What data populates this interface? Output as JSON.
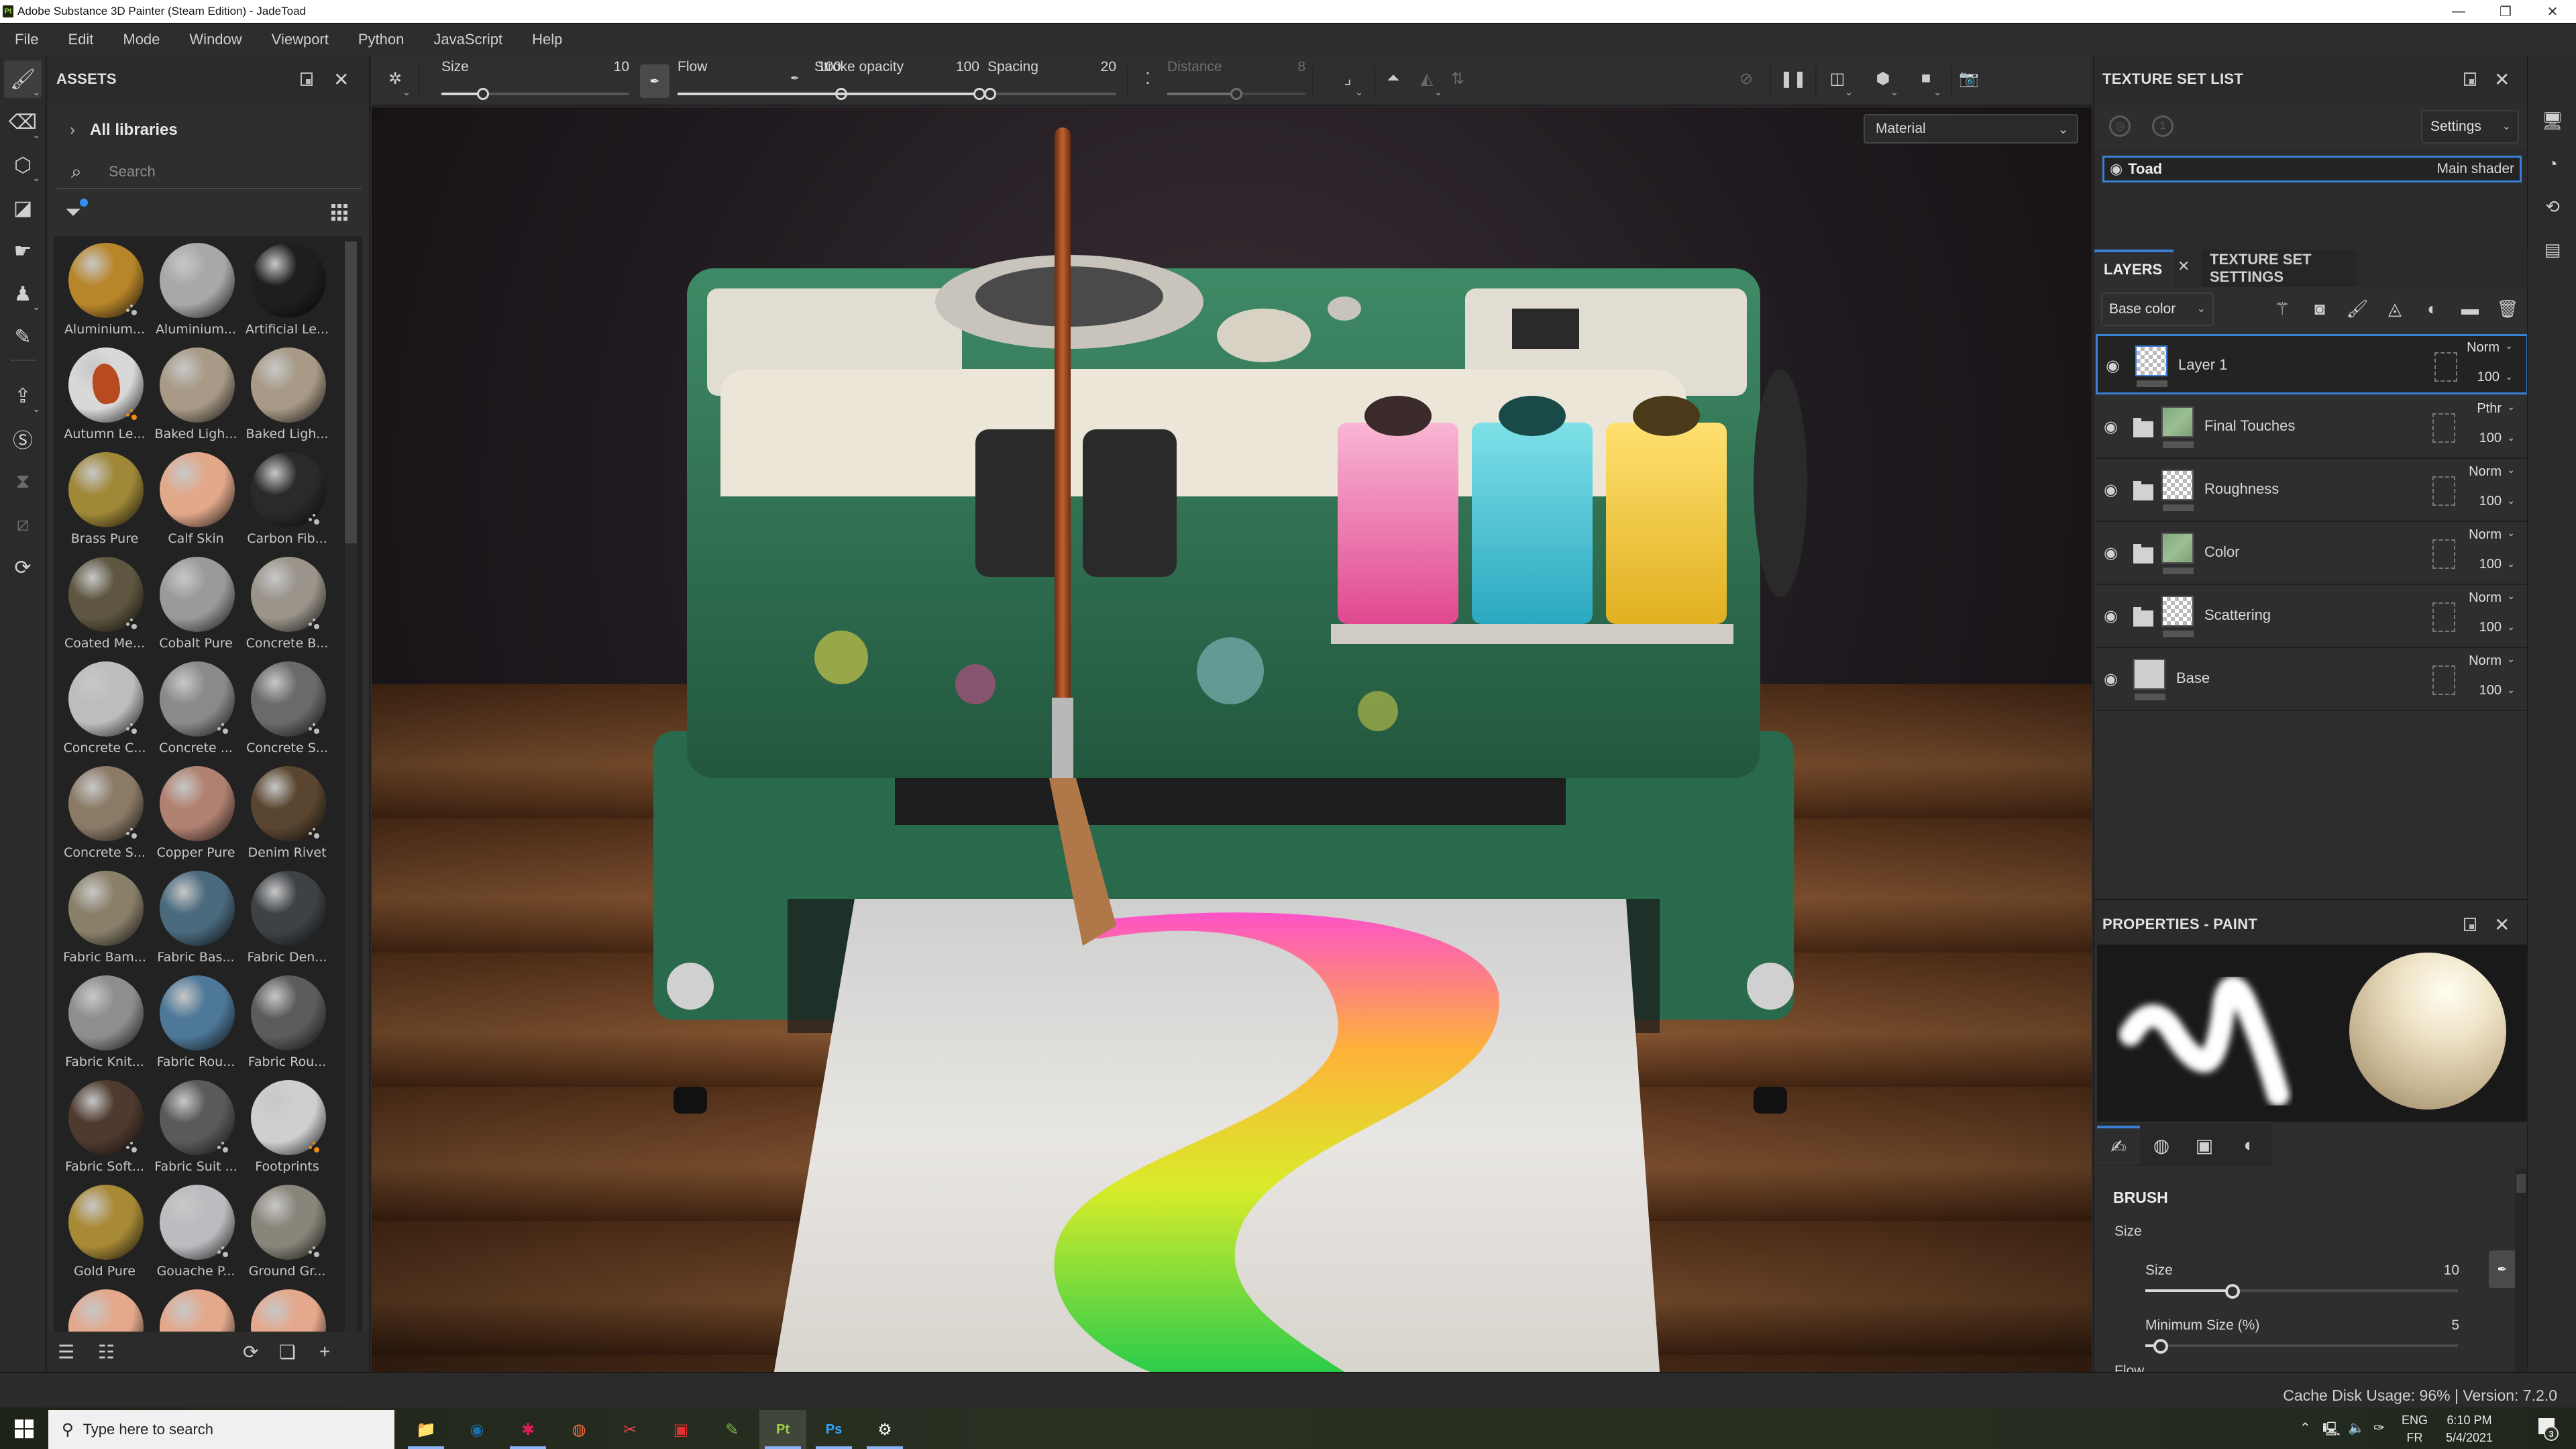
{
  "window": {
    "title": "Adobe Substance 3D Painter (Steam Edition) - JadeToad",
    "app_icon_text": "Pt",
    "controls": {
      "minimize": "—",
      "restore": "❐",
      "close": "✕"
    }
  },
  "menu": [
    "File",
    "Edit",
    "Mode",
    "Window",
    "Viewport",
    "Python",
    "JavaScript",
    "Help"
  ],
  "left_tools": [
    {
      "name": "paint-brush-tool",
      "glyph": "🖌",
      "active": true,
      "caret": true
    },
    {
      "name": "eraser-tool",
      "glyph": "⌫",
      "caret": true
    },
    {
      "name": "projection-tool",
      "glyph": "⬡",
      "caret": true
    },
    {
      "name": "geometry-fill-tool",
      "glyph": "◪"
    },
    {
      "name": "smudge-tool",
      "glyph": "☛"
    },
    {
      "name": "clone-stamp-tool",
      "glyph": "♟",
      "caret": true
    },
    {
      "name": "color-picker-tool",
      "glyph": "✎"
    },
    {
      "name": "export-tool",
      "glyph": "⇪",
      "caret": true
    },
    {
      "name": "substance-share-tool",
      "glyph": "Ⓢ"
    },
    {
      "name": "iray-render-tool",
      "glyph": "⧗",
      "dim": true
    },
    {
      "name": "uv-tool",
      "glyph": "⧄",
      "dim": true
    },
    {
      "name": "bake-tool",
      "glyph": "⟳"
    }
  ],
  "assets": {
    "title": "ASSETS",
    "library": "All libraries",
    "search_placeholder": "Search",
    "items": [
      {
        "label": "Aluminium...",
        "color": "#b8862a",
        "badge": "grey"
      },
      {
        "label": "Aluminium...",
        "color": "#a8a8a8"
      },
      {
        "label": "Artificial Le...",
        "color": "#1e1e1e"
      },
      {
        "label": "Autumn Le...",
        "color": "#d8d8d8",
        "badge": "orange",
        "leaf": true
      },
      {
        "label": "Baked Ligh...",
        "color": "#a89a86"
      },
      {
        "label": "Baked Ligh...",
        "color": "#a89a86"
      },
      {
        "label": "Brass Pure",
        "color": "#a08838"
      },
      {
        "label": "Calf Skin",
        "color": "#e2a88a"
      },
      {
        "label": "Carbon Fib...",
        "color": "#2a2a2a",
        "badge": "grey"
      },
      {
        "label": "Coated Me...",
        "color": "#5e5640",
        "badge": "grey"
      },
      {
        "label": "Cobalt Pure",
        "color": "#9a9a9a"
      },
      {
        "label": "Concrete B...",
        "color": "#9a948a",
        "badge": "grey"
      },
      {
        "label": "Concrete C...",
        "color": "#bdbdbd",
        "badge": "grey"
      },
      {
        "label": "Concrete ...",
        "color": "#8a8a88",
        "badge": "grey"
      },
      {
        "label": "Concrete S...",
        "color": "#6a6a6a",
        "badge": "grey"
      },
      {
        "label": "Concrete S...",
        "color": "#8a7a66",
        "badge": "grey"
      },
      {
        "label": "Copper Pure",
        "color": "#b08070"
      },
      {
        "label": "Denim Rivet",
        "color": "#5a4630",
        "badge": "grey"
      },
      {
        "label": "Fabric Bam...",
        "color": "#8a806a"
      },
      {
        "label": "Fabric Bas...",
        "color": "#4a6a7e"
      },
      {
        "label": "Fabric Den...",
        "color": "#3e4246"
      },
      {
        "label": "Fabric Knit...",
        "color": "#8e8e8e"
      },
      {
        "label": "Fabric Rou...",
        "color": "#4e7898"
      },
      {
        "label": "Fabric Rou...",
        "color": "#5e5c5a"
      },
      {
        "label": "Fabric Soft...",
        "color": "#4e3a2e",
        "badge": "grey"
      },
      {
        "label": "Fabric Suit ...",
        "color": "#5a5a5a",
        "badge": "grey"
      },
      {
        "label": "Footprints",
        "color": "#cfcfcf",
        "badge": "orange"
      },
      {
        "label": "Gold Pure",
        "color": "#a88a36"
      },
      {
        "label": "Gouache P...",
        "color": "#bcbcc0",
        "badge": "grey"
      },
      {
        "label": "Ground Gr...",
        "color": "#8a857a",
        "badge": "grey"
      },
      {
        "label": "",
        "color": "#e4a88c"
      },
      {
        "label": "",
        "color": "#e4a88c"
      },
      {
        "label": "",
        "color": "#e4a88c"
      }
    ],
    "footer_buttons": [
      {
        "name": "save-library-icon",
        "glyph": "☰"
      },
      {
        "name": "import-folder-icon",
        "glyph": "☷"
      },
      {
        "name": "refresh-icon",
        "glyph": "⟳"
      },
      {
        "name": "new-window-icon",
        "glyph": "❏"
      },
      {
        "name": "add-icon",
        "glyph": "+"
      }
    ]
  },
  "toolbar": {
    "size": {
      "label": "Size",
      "value": "10",
      "fraction": 0.22
    },
    "flow": {
      "label": "Flow",
      "value": "100",
      "fraction": 1.0
    },
    "stroke_opacity": {
      "label": "Stroke opacity",
      "value": "100",
      "fraction": 1.0
    },
    "spacing": {
      "label": "Spacing",
      "value": "20",
      "fraction": 0.02
    },
    "distance": {
      "label": "Distance",
      "value": "8",
      "fraction": 0.5
    }
  },
  "viewport": {
    "display_mode": "Material"
  },
  "texture_set_list": {
    "title": "TEXTURE SET LIST",
    "settings_label": "Settings",
    "sets": [
      {
        "name": "Toad",
        "shader": "Main shader"
      }
    ]
  },
  "layers": {
    "tab_active": "LAYERS",
    "tab_inactive": "TEXTURE SET SETTINGS",
    "channel": "Base color",
    "items": [
      {
        "name": "Layer 1",
        "blend": "Norm",
        "opacity": "100",
        "folder": false,
        "thumb": "checker",
        "selected": true
      },
      {
        "name": "Final Touches",
        "blend": "Pthr",
        "opacity": "100",
        "folder": true,
        "thumb": "green"
      },
      {
        "name": "Roughness",
        "blend": "Norm",
        "opacity": "100",
        "folder": true,
        "thumb": "checker"
      },
      {
        "name": "Color",
        "blend": "Norm",
        "opacity": "100",
        "folder": true,
        "thumb": "green"
      },
      {
        "name": "Scattering",
        "blend": "Norm",
        "opacity": "100",
        "folder": true,
        "thumb": "checker"
      },
      {
        "name": "Base",
        "blend": "Norm",
        "opacity": "100",
        "folder": false,
        "thumb": "grey"
      }
    ]
  },
  "properties": {
    "title": "PROPERTIES - PAINT",
    "section": "BRUSH",
    "group": "Size",
    "sliders": [
      {
        "label": "Size",
        "value": "10",
        "fraction": 0.28
      },
      {
        "label": "Minimum Size (%)",
        "value": "5",
        "fraction": 0.05
      }
    ],
    "next_group": "Flow"
  },
  "status": {
    "text": "Cache Disk Usage: 96% | Version: 7.2.0"
  },
  "taskbar": {
    "search_placeholder": "Type here to search",
    "apps": [
      {
        "name": "file-explorer",
        "glyph": "📁",
        "color": "#f4c542",
        "open": true
      },
      {
        "name": "steam",
        "glyph": "◉",
        "color": "#1b6fa8"
      },
      {
        "name": "slack",
        "glyph": "✱",
        "color": "#e01e5a",
        "open": true
      },
      {
        "name": "firefox",
        "glyph": "◍",
        "color": "#ff7139"
      },
      {
        "name": "snipping-tool",
        "glyph": "✂",
        "color": "#e05050"
      },
      {
        "name": "screen-recorder",
        "glyph": "▣",
        "color": "#e03030"
      },
      {
        "name": "notepad-plus",
        "glyph": "✎",
        "color": "#7ab648"
      },
      {
        "name": "substance-painter",
        "glyph": "Pt",
        "color": "#9bd14b",
        "open": true,
        "active": true
      },
      {
        "name": "photoshop",
        "glyph": "Ps",
        "color": "#31a8ff",
        "open": true
      },
      {
        "name": "settings",
        "glyph": "⚙",
        "color": "#ffffff",
        "open": true
      }
    ],
    "lang_top": "ENG",
    "lang_bottom": "FR",
    "time": "6:10 PM",
    "date": "5/4/2021",
    "notifications": "3"
  }
}
